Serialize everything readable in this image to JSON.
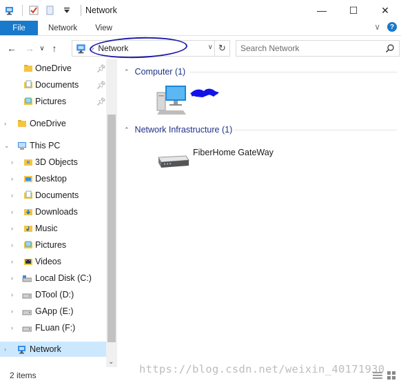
{
  "window": {
    "title": "Network",
    "controls": {
      "minimize": "—",
      "maximize": "☐",
      "close": "✕"
    }
  },
  "quick_access": {
    "icons": [
      "network-app-icon",
      "properties-icon",
      "new-folder-icon",
      "customize-dropdown-icon"
    ]
  },
  "ribbon": {
    "tabs": [
      "File",
      "Network",
      "View"
    ],
    "expand_glyph": "∨",
    "help_glyph": "?"
  },
  "address": {
    "crumb": "Network",
    "back": "←",
    "forward": "→",
    "recent": "∨",
    "up": "↑",
    "refresh": "↻"
  },
  "search": {
    "placeholder": "Search Network"
  },
  "nav": {
    "quick_access_items": [
      {
        "label": "OneDrive",
        "icon": "folder-icon",
        "pinned": true
      },
      {
        "label": "Documents",
        "icon": "documents-icon",
        "pinned": true
      },
      {
        "label": "Pictures",
        "icon": "pictures-icon",
        "pinned": true
      }
    ],
    "onedrive": {
      "label": "OneDrive"
    },
    "this_pc": {
      "label": "This PC"
    },
    "this_pc_items": [
      {
        "label": "3D Objects",
        "icon": "3d-objects-icon"
      },
      {
        "label": "Desktop",
        "icon": "desktop-icon"
      },
      {
        "label": "Documents",
        "icon": "documents-icon"
      },
      {
        "label": "Downloads",
        "icon": "downloads-icon"
      },
      {
        "label": "Music",
        "icon": "music-icon"
      },
      {
        "label": "Pictures",
        "icon": "pictures-icon"
      },
      {
        "label": "Videos",
        "icon": "videos-icon"
      },
      {
        "label": "Local Disk (C:)",
        "icon": "local-disk-icon"
      },
      {
        "label": "DTool (D:)",
        "icon": "drive-icon"
      },
      {
        "label": "GApp (E:)",
        "icon": "drive-icon"
      },
      {
        "label": "FLuan (F:)",
        "icon": "drive-icon"
      }
    ],
    "network": {
      "label": "Network"
    }
  },
  "content": {
    "groups": [
      {
        "header": "Computer (1)",
        "items": [
          {
            "label": "",
            "icon": "computer-icon",
            "label_redacted": true
          }
        ]
      },
      {
        "header": "Network Infrastructure (1)",
        "items": [
          {
            "label": "FiberHome GateWay",
            "icon": "router-icon"
          }
        ]
      }
    ]
  },
  "status": {
    "item_count": "2 items"
  },
  "watermark": "https://blog.csdn.net/weixin_40171930",
  "colors": {
    "accent": "#1979ca",
    "selection": "#cce8ff",
    "group_header": "#1e3287",
    "annotation_ink": "#1a1aa8",
    "redaction": "#1212e8"
  }
}
